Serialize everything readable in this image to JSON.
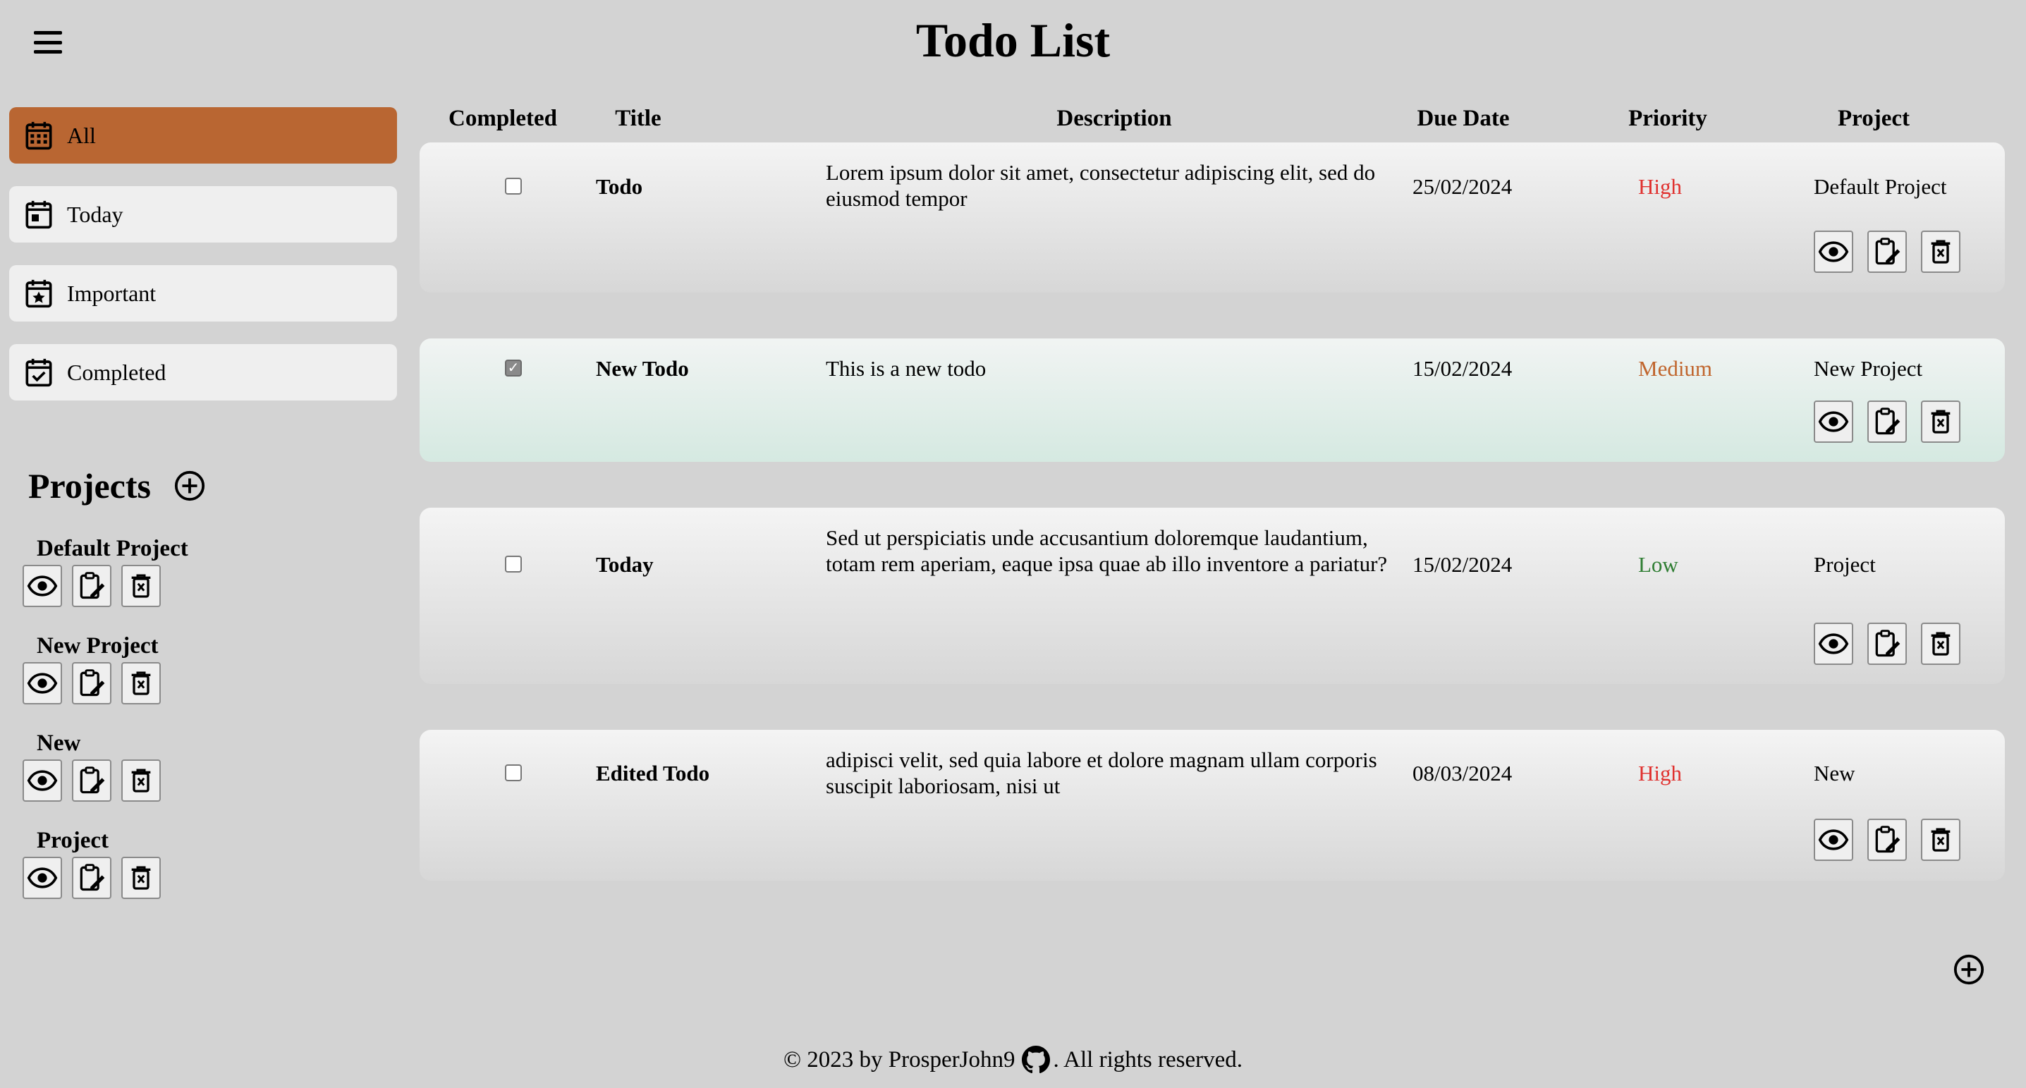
{
  "header": {
    "title": "Todo List",
    "menu_icon": "hamburger-menu-icon"
  },
  "sidebar": {
    "nav": [
      {
        "label": "All",
        "icon": "calendar-grid-icon",
        "active": true
      },
      {
        "label": "Today",
        "icon": "calendar-day-icon",
        "active": false
      },
      {
        "label": "Important",
        "icon": "calendar-star-icon",
        "active": false
      },
      {
        "label": "Completed",
        "icon": "calendar-check-icon",
        "active": false
      }
    ],
    "projects_heading": "Projects",
    "projects": [
      {
        "name": "Default Project"
      },
      {
        "name": "New Project"
      },
      {
        "name": "New"
      },
      {
        "name": "Project"
      }
    ]
  },
  "table": {
    "headers": [
      "Completed",
      "Title",
      "Description",
      "Due Date",
      "Priority",
      "Project"
    ],
    "rows": [
      {
        "completed": false,
        "title": "Todo",
        "description": "Lorem ipsum dolor sit amet, consectetur adipiscing elit, sed do eiusmod tempor",
        "due": "25/02/2024",
        "priority": "High",
        "project": "Default Project"
      },
      {
        "completed": true,
        "title": "New Todo",
        "description": "This is a new todo",
        "due": "15/02/2024",
        "priority": "Medium",
        "project": "New Project"
      },
      {
        "completed": false,
        "title": "Today",
        "description": "Sed ut perspiciatis unde accusantium doloremque laudantium, totam rem aperiam, eaque ipsa quae ab illo inventore a pariatur?",
        "due": "15/02/2024",
        "priority": "Low",
        "project": "Project"
      },
      {
        "completed": false,
        "title": "Edited Todo",
        "description": "adipisci velit, sed quia labore et dolore magnam ullam corporis suscipit laboriosam, nisi ut",
        "due": "08/03/2024",
        "priority": "High",
        "project": "New"
      }
    ]
  },
  "colors": {
    "background": "#d3d3d3",
    "accent": "#b96632",
    "high": "#e0302e",
    "medium": "#c0652d",
    "low": "#2e7d32"
  },
  "footer": {
    "prefix": "© 2023 by ProsperJohn9",
    "suffix": ". All rights reserved.",
    "icon": "github-icon"
  }
}
